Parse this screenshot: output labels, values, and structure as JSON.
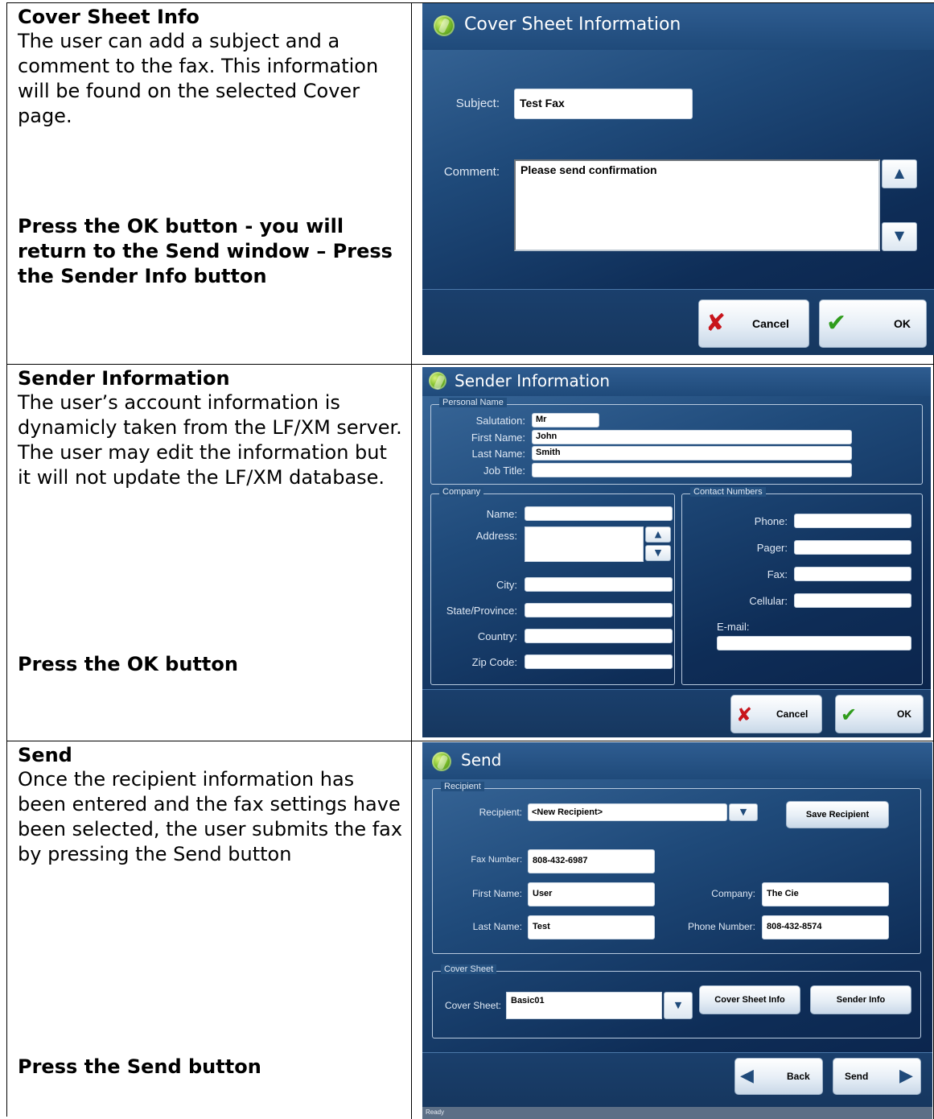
{
  "sections": [
    {
      "title": "Cover Sheet Info",
      "body": "The user can add a subject and a comment to the fax. This information will be found on the selected Cover page.",
      "action": "Press the OK button -  you will return to the Send window – Press the Sender Info button"
    },
    {
      "title": "Sender Information",
      "body": "The user’s account information is dynamicly taken from the LF/XM server. The user may edit the information but it will not update the LF/XM database.",
      "action": "Press the OK button"
    },
    {
      "title": "Send",
      "body": "Once the recipient information has been entered and the fax settings have been selected, the user submits the fax by pressing the Send button",
      "action": "Press the Send button"
    }
  ],
  "cover_window": {
    "title": "Cover Sheet Information",
    "subject_label": "Subject:",
    "subject_value": "Test Fax",
    "comment_label": "Comment:",
    "comment_value": "Please send confirmation",
    "cancel_label": "Cancel",
    "ok_label": "OK"
  },
  "sender_window": {
    "title": "Sender Information",
    "personal_legend": "Personal Name",
    "salutation_label": "Salutation:",
    "salutation_value": "Mr",
    "first_name_label": "First Name:",
    "first_name_value": "John",
    "last_name_label": "Last Name:",
    "last_name_value": "Smith",
    "job_title_label": "Job Title:",
    "job_title_value": "",
    "company_legend": "Company",
    "company_name_label": "Name:",
    "address_label": "Address:",
    "city_label": "City:",
    "state_label": "State/Province:",
    "country_label": "Country:",
    "zip_label": "Zip Code:",
    "contact_legend": "Contact Numbers",
    "phone_label": "Phone:",
    "pager_label": "Pager:",
    "fax_label": "Fax:",
    "cellular_label": "Cellular:",
    "email_label": "E-mail:",
    "cancel_label": "Cancel",
    "ok_label": "OK"
  },
  "send_window": {
    "title": "Send",
    "recipient_legend": "Recipient",
    "recipient_label": "Recipient:",
    "recipient_value": "<New Recipient>",
    "save_recipient_label": "Save Recipient",
    "fax_number_label": "Fax Number:",
    "fax_number_value": "808-432-6987",
    "first_name_label": "First Name:",
    "first_name_value": "User",
    "company_label": "Company:",
    "company_value": "The Cie",
    "last_name_label": "Last Name:",
    "last_name_value": "Test",
    "phone_number_label": "Phone Number:",
    "phone_number_value": "808-432-8574",
    "cover_legend": "Cover Sheet",
    "cover_sheet_label": "Cover Sheet:",
    "cover_sheet_value": "Basic01",
    "cover_sheet_info_label": "Cover Sheet Info",
    "sender_info_label": "Sender Info",
    "back_label": "Back",
    "send_label": "Send",
    "status_text": "Ready"
  },
  "icons": {
    "logo": "app-logo-icon",
    "cancel": "red-x-icon",
    "ok": "green-check-icon",
    "up": "up-arrow-icon",
    "down": "down-arrow-icon",
    "back": "left-arrow-icon",
    "send": "right-arrow-icon"
  },
  "colors": {
    "window_blue": "#1f4a7a",
    "cancel_red": "#c8151c",
    "ok_green": "#2f9c1c"
  }
}
